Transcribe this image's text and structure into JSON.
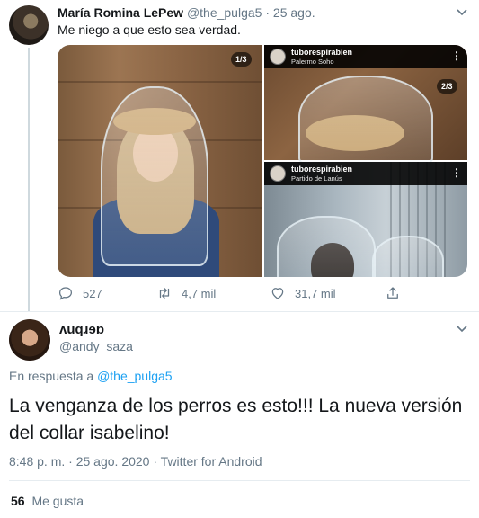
{
  "tweet": {
    "author_name": "María Romina LePew",
    "handle": "@the_pulga5",
    "separator": "·",
    "date": "25 ago.",
    "text": "Me niego a que esto sea verdad.",
    "media": {
      "first_counter": "1/3",
      "second_counter": "2/3",
      "top_right": {
        "username": "tuborespirabien",
        "location": "Palermo Soho"
      },
      "bottom_right": {
        "username": "tuborespirabien",
        "location": "Partido de Lanús"
      }
    },
    "actions": {
      "replies": "527",
      "retweets": "4,7 mil",
      "likes": "31,7 mil"
    }
  },
  "reply": {
    "author_name": "ʌuqɹɘɒ",
    "handle": "@andy_saza_",
    "in_reply_prefix": "En respuesta a",
    "in_reply_handle": "@the_pulga5",
    "text": "La venganza de los perros es esto!!! La nueva versión del collar isabelino!",
    "time": "8:48 p. m.",
    "date": "25 ago. 2020",
    "separator": "·",
    "source": "Twitter for Android",
    "like_count": "56",
    "like_label": "Me gusta"
  },
  "colors": {
    "link": "#1da1f2",
    "secondary_text": "#657786",
    "primary_text": "#14171a",
    "divider": "#e6ecf0"
  },
  "icons": [
    "caret-down-icon",
    "reply-icon",
    "retweet-icon",
    "like-icon",
    "share-icon",
    "more-dots-icon"
  ]
}
